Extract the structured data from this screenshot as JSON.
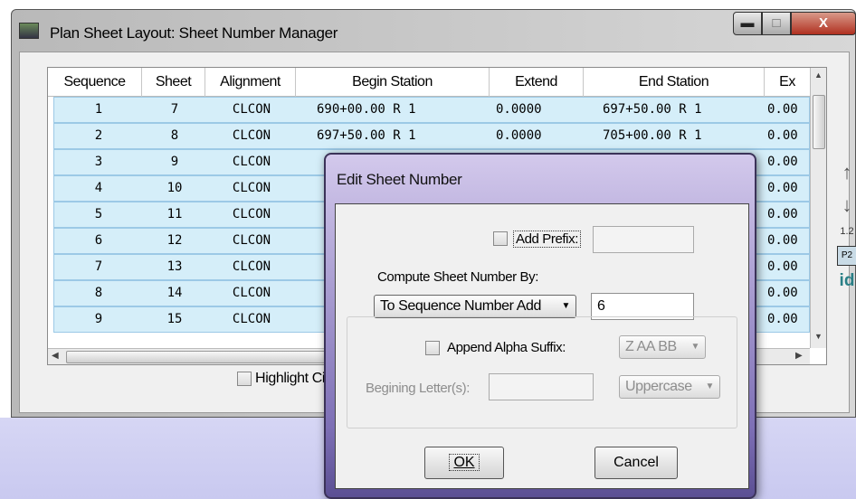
{
  "window": {
    "title": "Plan Sheet Layout: Sheet Number Manager",
    "min_glyph": "▬",
    "max_glyph": "□",
    "close_glyph": "X"
  },
  "table": {
    "columns": [
      "Sequence",
      "Sheet",
      "Alignment",
      "Begin Station",
      "Extend",
      "End Station",
      "Ex"
    ],
    "rows": [
      {
        "sequence": "1",
        "sheet": "7",
        "alignment": "CLCON",
        "begin_station": "690+00.00 R 1",
        "extend": "0.0000",
        "end_station": "697+50.00 R 1",
        "ex": "0.00"
      },
      {
        "sequence": "2",
        "sheet": "8",
        "alignment": "CLCON",
        "begin_station": "697+50.00 R 1",
        "extend": "0.0000",
        "end_station": "705+00.00 R 1",
        "ex": "0.00"
      },
      {
        "sequence": "3",
        "sheet": "9",
        "alignment": "CLCON",
        "begin_station": "",
        "extend": "",
        "end_station": "",
        "ex": "0.00"
      },
      {
        "sequence": "4",
        "sheet": "10",
        "alignment": "CLCON",
        "begin_station": "",
        "extend": "",
        "end_station": "",
        "ex": "0.00"
      },
      {
        "sequence": "5",
        "sheet": "11",
        "alignment": "CLCON",
        "begin_station": "",
        "extend": "",
        "end_station": "",
        "ex": "0.00"
      },
      {
        "sequence": "6",
        "sheet": "12",
        "alignment": "CLCON",
        "begin_station": "",
        "extend": "",
        "end_station": "",
        "ex": "0.00"
      },
      {
        "sequence": "7",
        "sheet": "13",
        "alignment": "CLCON",
        "begin_station": "",
        "extend": "",
        "end_station": "",
        "ex": "0.00"
      },
      {
        "sequence": "8",
        "sheet": "14",
        "alignment": "CLCON",
        "begin_station": "",
        "extend": "",
        "end_station": "",
        "ex": "0.00"
      },
      {
        "sequence": "9",
        "sheet": "15",
        "alignment": "CLCON",
        "begin_station": "",
        "extend": "",
        "end_station": "",
        "ex": "0.00"
      }
    ]
  },
  "highlight_label": "Highlight Ci",
  "side_toolbar": {
    "up_glyph": "↑",
    "down_glyph": "↓",
    "renumber_glyph": "1.2",
    "p2_glyph": "P2",
    "id_label": "id"
  },
  "dialog": {
    "title": "Edit Sheet Number",
    "add_prefix_label": "Add Prefix:",
    "add_prefix_value": "",
    "compute_label": "Compute Sheet Number By:",
    "compute_mode": "To Sequence Number Add",
    "compute_value": "6",
    "append_suffix_label": "Append Alpha Suffix:",
    "suffix_format": "Z AA BB",
    "beginning_letters_label": "Begining Letter(s):",
    "beginning_letters_value": "",
    "case_option": "Uppercase",
    "ok_label": "OK",
    "cancel_label": "Cancel"
  }
}
